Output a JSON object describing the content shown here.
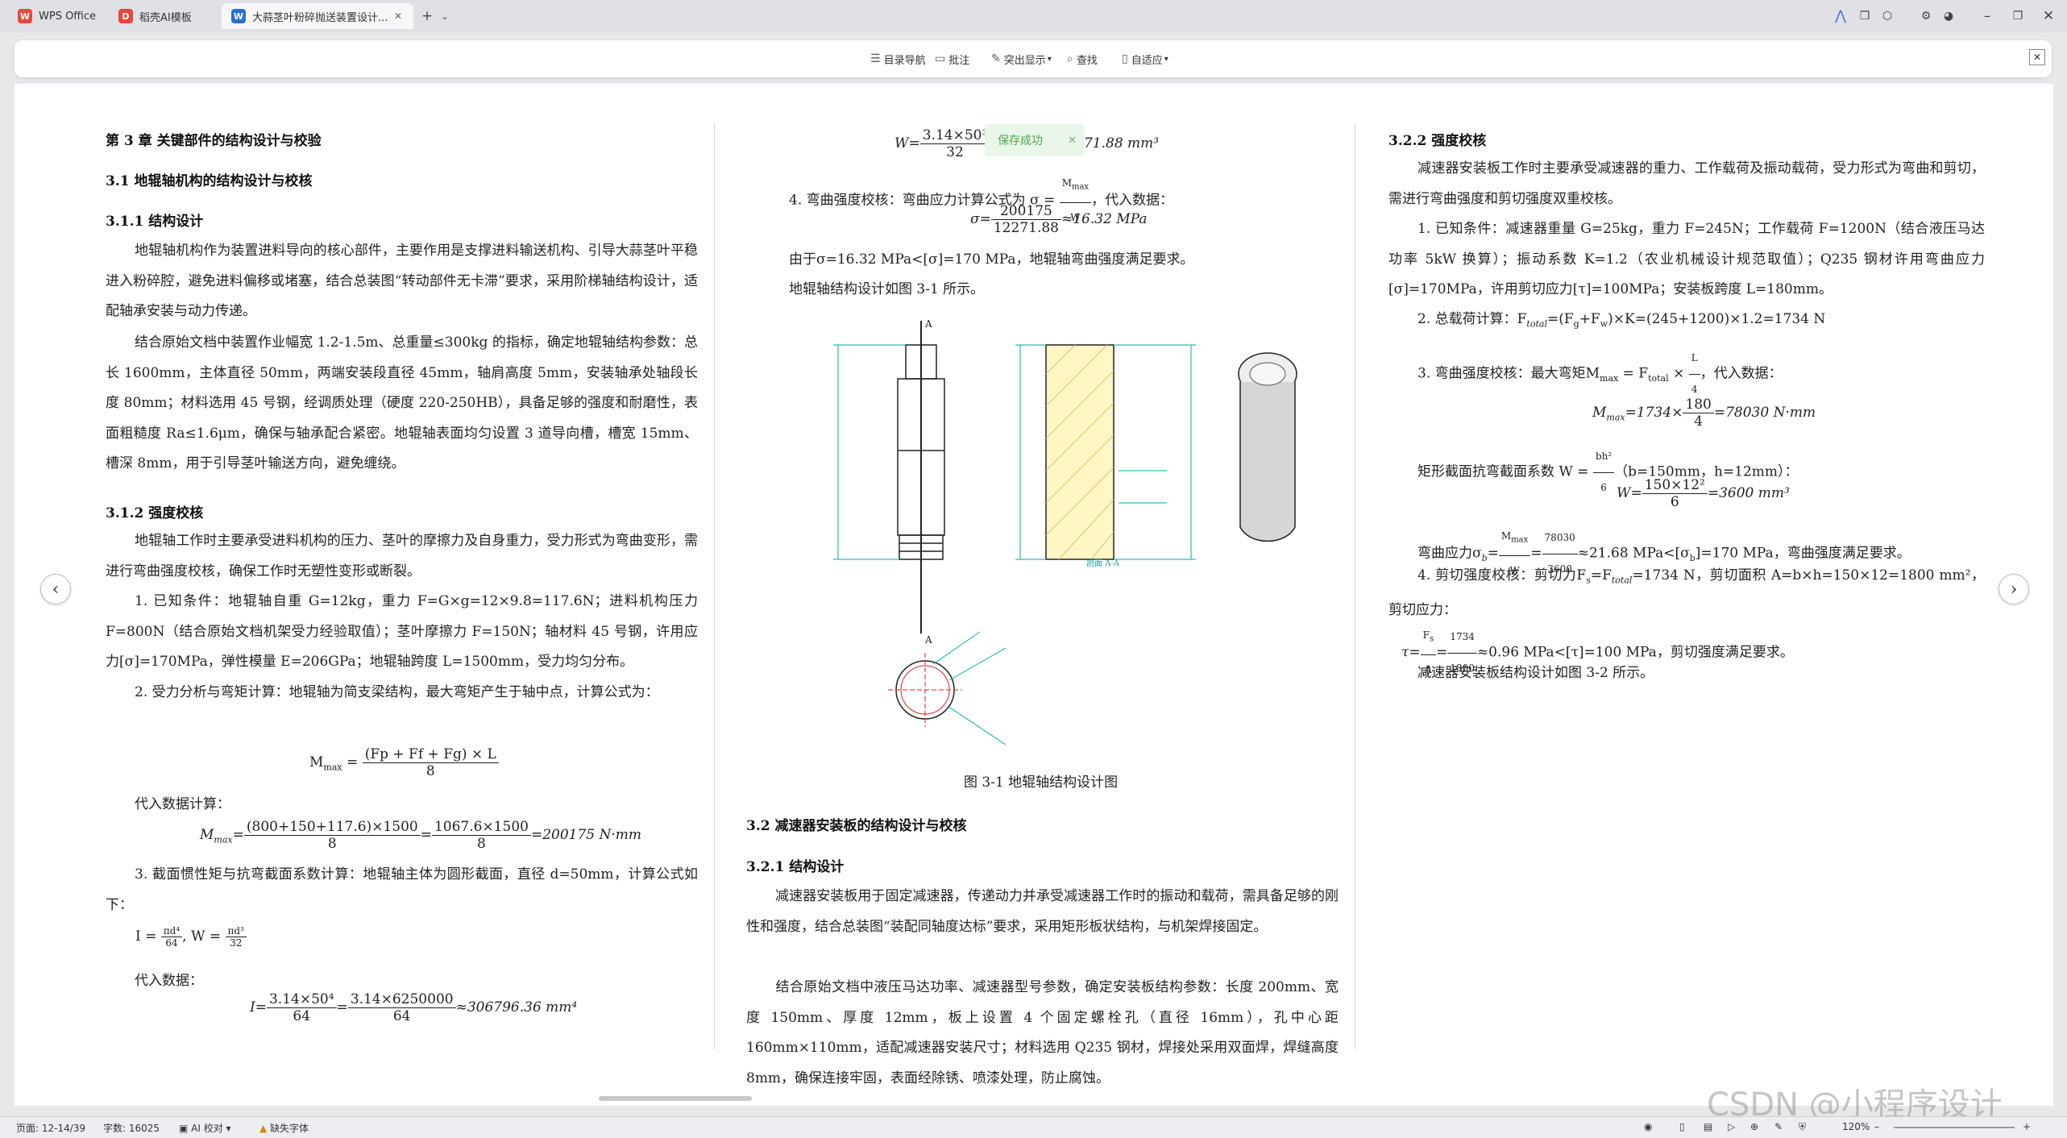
{
  "tabs": [
    {
      "label": "WPS Office",
      "active": false
    },
    {
      "label": "稻壳AI模板",
      "active": false
    },
    {
      "label": "大蒜茎叶粉碎抛送装置设计...",
      "active": true
    }
  ],
  "toolbar": {
    "nav": "目录导航",
    "comment": "批注",
    "highlight": "突出显示",
    "find": "查找",
    "adapt": "自适应"
  },
  "toast": "保存成功",
  "col1": {
    "ch": "第 3 章  关键部件的结构设计与校验",
    "s31": "3.1  地辊轴机构的结构设计与校核",
    "s311": "3.1.1  结构设计",
    "p1": "地辊轴机构作为装置进料导向的核心部件，主要作用是支撑进料输送机构、引导大蒜茎叶平稳进入粉碎腔，避免进料偏移或堵塞，结合总装图“转动部件无卡滞”要求，采用阶梯轴结构设计，适配轴承安装与动力传递。",
    "p2": "结合原始文档中装置作业幅宽 1.2-1.5m、总重量≤300kg 的指标，确定地辊轴结构参数：总长 1600mm，主体直径 50mm，两端安装段直径 45mm，轴肩高度 5mm，安装轴承处轴段长度 80mm；材料选用 45 号钢，经调质处理（硬度 220-250HB），具备足够的强度和耐磨性，表面粗糙度 Ra≤1.6μm，确保与轴承配合紧密。地辊轴表面均匀设置 3 道导向槽，槽宽 15mm、槽深 8mm，用于引导茎叶输送方向，避免缠绕。",
    "s312": "3.1.2  强度校核",
    "p3": "地辊轴工作时主要承受进料机构的压力、茎叶的摩擦力及自身重力，受力形式为弯曲变形，需进行弯曲强度校核，确保工作时无塑性变形或断裂。",
    "p4": "1. 已知条件：地辊轴自重 G=12kg，重力 F=G×g=12×9.8=117.6N；进料机构压力 F=800N（结合原始文档机架受力经验取值）；茎叶摩擦力 F=150N；轴材料 45 号钢，许用应力[σ]=170MPa，弹性模量 E=206GPa；地辊轴跨度 L=1500mm，受力均匀分布。",
    "p5": "2. 受力分析与弯矩计算：地辊轴为简支梁结构，最大弯矩产生于轴中点，计算公式为：",
    "f1n": "(Fp + Ff + Fg) × L",
    "f1d": "8",
    "p6": "代入数据计算：",
    "f2n1": "(800+150+117.6)×1500",
    "f2d1": "8",
    "f2n2": "1067.6×1500",
    "f2d2": "8",
    "f2r": "=200175 N·mm",
    "p7": "3. 截面惯性矩与抗弯截面系数计算：地辊轴主体为圆形截面，直径 d=50mm，计算公式如下：",
    "p8": "代入数据：",
    "f4n1": "3.14×50⁴",
    "f4d1": "64",
    "f4n2": "3.14×6250000",
    "f4d2": "64",
    "f4r": "≈306796.36 mm⁴"
  },
  "col2": {
    "f5n": "3.14×50³",
    "f5d": "32",
    "f5r": "12271.88 mm³",
    "p1": "4. 弯曲强度校核：弯曲应力计算公式为 σ =",
    "p1b": "，代入数据：",
    "f6n": "200175",
    "f6d": "12271.88",
    "f6r": "≈16.32 MPa",
    "p2": "由于σ=16.32 MPa<[σ]=170 MPa，地辊轴弯曲强度满足要求。",
    "p3": "地辊轴结构设计如图 3-1 所示。",
    "fig_cap": "图 3-1  地辊轴结构设计图",
    "s32": "3.2  减速器安装板的结构设计与校核",
    "s321": "3.2.1  结构设计",
    "p4": "减速器安装板用于固定减速器，传递动力并承受减速器工作时的振动和载荷，需具备足够的刚性和强度，结合总装图“装配同轴度达标”要求，采用矩形板状结构，与机架焊接固定。",
    "p5": "结合原始文档中液压马达功率、减速器型号参数，确定安装板结构参数：长度 200mm、宽度 150mm、厚度 12mm，板上设置 4 个固定螺栓孔（直径 16mm），孔中心距 160mm×110mm，适配减速器安装尺寸；材料选用 Q235 钢材，焊接处采用双面焊，焊缝高度 8mm，确保连接牢固，表面经除锈、喷漆处理，防止腐蚀。"
  },
  "col3": {
    "s322": "3.2.2  强度校核",
    "p1": "减速器安装板工作时主要承受减速器的重力、工作载荷及振动载荷，受力形式为弯曲和剪切，需进行弯曲强度和剪切强度双重校核。",
    "p2": "1. 已知条件：减速器重量 G=25kg，重力 F=245N；工作载荷 F=1200N（结合液压马达功率 5kW 换算）；振动系数 K=1.2（农业机械设计规范取值）；Q235 钢材许用弯曲应力[σ]=170MPa，许用剪切应力[τ]=100MPa；安装板跨度 L=180mm。",
    "p3": "2. 总载荷计算：F",
    "p3b": "=(F",
    "p3c": "+F",
    "p3d": ")×K=(245+1200)×1.2=1734 N",
    "p4": "3. 弯曲强度校核：最大弯矩M",
    "p4b": " = F",
    "p4c": " × ",
    "p4d": "，代入数据：",
    "f7l": "M",
    "f7m": "=1734×",
    "f7n": "180",
    "f7d": "4",
    "f7r": "=78030 N·mm",
    "p5": "矩形截面抗弯截面系数 W =",
    "p5b": "（b=150mm，h=12mm）：",
    "f8n": "150×12²",
    "f8d": "6",
    "f8r": "=3600 mm³",
    "p6": "弯曲应力σ",
    "p6b": "≈21.68 MPa<[σ",
    "p6c": "]=170 MPa，弯曲强度满足要求。",
    "p7": "4. 剪切强度校核：剪切力F",
    "p7b": "=F",
    "p7c": "=1734 N，剪切面积 A=b×h=150×12=1800 mm²，剪切应力：",
    "p8": "≈0.96 MPa<[τ]=100 MPa，剪切强度满足要求。",
    "p9": "减速器安装板结构设计如图 3-2 所示。"
  },
  "status": {
    "page": "页面: 12-14/39",
    "words": "字数: 16025",
    "ai": "AI 校对",
    "font": "缺失字体",
    "zoom": "120%"
  },
  "watermark": "CSDN @小程序设计"
}
